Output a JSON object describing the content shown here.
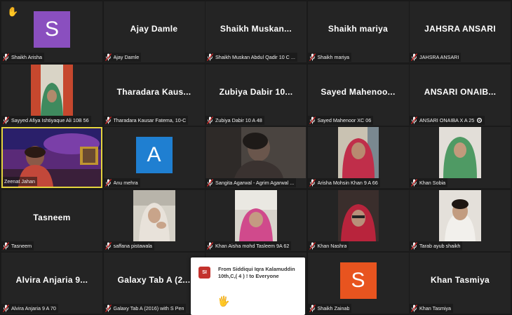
{
  "raise_hand_icon": "✋",
  "tiles": [
    {
      "label": "Shaikh Arisha",
      "avatar": "S",
      "avatar_color": "#8a4fbf"
    },
    {
      "label": "Ajay Damle",
      "display": "Ajay Damle"
    },
    {
      "label": "Shaikh Muskan Abdul Qadir 10 C ...",
      "display": "Shaikh  Muskan..."
    },
    {
      "label": "Shaikh mariya",
      "display": "Shaikh mariya"
    },
    {
      "label": "JAHSRA ANSARI",
      "display": "JAHSRA ANSARI"
    },
    {
      "label": "Sayyed Afiya Ishtiyaque Ali  10B 56"
    },
    {
      "label": "Tharadara Kausar Fatema, 10-C",
      "display": "Tharadara  Kaus..."
    },
    {
      "label": "Zubiya Dabir 10 A 48",
      "display": "Zubiya Dabir 10..."
    },
    {
      "label": "Sayed Mahenoor XC 06",
      "display": "Sayed Mahenoo..."
    },
    {
      "label": "ANSARI ONAIBA X A 25",
      "display": "ANSARI  ONAIB..."
    },
    {
      "label": "Zeenat Jahan"
    },
    {
      "label": "Anu mehra",
      "avatar": "A",
      "avatar_color": "#1f7fd1"
    },
    {
      "label": "Sangita Agarwal - Agrim Agarwal ..."
    },
    {
      "label": "Arisha Mohsin Khan 9 A 66"
    },
    {
      "label": "Khan Sobia"
    },
    {
      "label": "Tasneem",
      "display": "Tasneem"
    },
    {
      "label": "saffana pistawala"
    },
    {
      "label": "Khan Aisha mohd Tasleem 9A 62"
    },
    {
      "label": "Khan Nashra"
    },
    {
      "label": "Tarab ayub shaikh"
    },
    {
      "label": "Alvira Anjaria 9 A 70",
      "display": "Alvira Anjaria 9..."
    },
    {
      "label": "Galaxy Tab A (2016) with S Pen",
      "display": "Galaxy Tab A (2..."
    },
    {
      "label": "Shaikh Zainab",
      "avatar": "S",
      "avatar_color": "#e8541f"
    },
    {
      "label": "Khan Tasmiya",
      "display": "Khan Tasmiya"
    }
  ],
  "chat_popup": {
    "initials": "SI",
    "message": "From Siddiqui Iqra Kalamuddin 10th,C,( 4 ) ! to Everyone",
    "emoji": "🖐"
  }
}
